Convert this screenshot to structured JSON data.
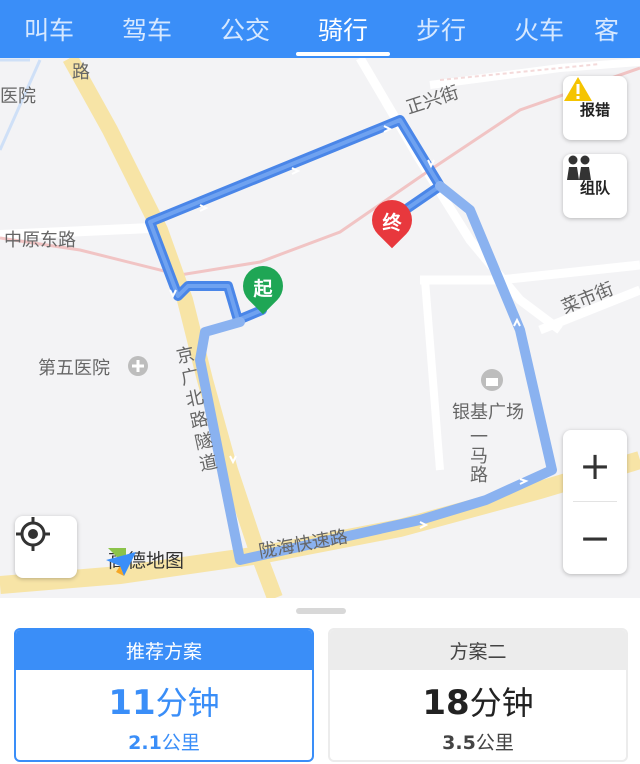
{
  "tabs": [
    {
      "label": "叫车",
      "active": false
    },
    {
      "label": "驾车",
      "active": false
    },
    {
      "label": "公交",
      "active": false
    },
    {
      "label": "骑行",
      "active": true
    },
    {
      "label": "步行",
      "active": false
    },
    {
      "label": "火车",
      "active": false
    },
    {
      "label": "客",
      "active": false
    }
  ],
  "map": {
    "labels": {
      "road_top": "路",
      "hospital_top": "医院",
      "zhengxing": "正兴街",
      "zhongyuan": "中原东路",
      "caishi": "菜市街",
      "fifth_hospital": "第五医院",
      "yinji": "银基广场",
      "yima": "一马路",
      "jingguang": "京广北路隧道",
      "longhai": "陇海快速路"
    },
    "start_pin": "起",
    "end_pin": "终",
    "route_color": "#4a86e8",
    "alt_route_color": "#8ab2f0",
    "start_color": "#1fa655",
    "end_color": "#e8383d"
  },
  "controls": {
    "report_label": "报错",
    "group_label": "组队",
    "zoom_in": "+",
    "zoom_out": "−",
    "locate_icon": "crosshair-icon"
  },
  "brand": {
    "name": "高德地图"
  },
  "plans": [
    {
      "title": "推荐方案",
      "minutes": "11",
      "min_unit": "分钟",
      "distance": "2.1",
      "dist_unit": "公里",
      "selected": true
    },
    {
      "title": "方案二",
      "minutes": "18",
      "min_unit": "分钟",
      "distance": "3.5",
      "dist_unit": "公里",
      "selected": false
    }
  ]
}
